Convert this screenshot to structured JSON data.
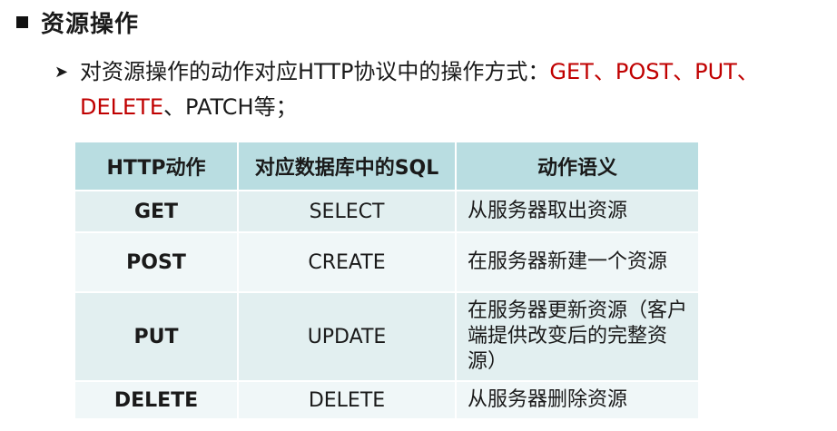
{
  "heading": {
    "title": "资源操作"
  },
  "bullet": {
    "text_before": "对资源操作的动作对应HTTP协议中的操作方式：",
    "methods_line1": "GET、POST、PUT、",
    "methods_line2_red": "DELETE",
    "methods_line2_rest": "、PATCH等；"
  },
  "table": {
    "headers": [
      "HTTP动作",
      "对应数据库中的SQL",
      "动作语义"
    ],
    "rows": [
      {
        "action": "GET",
        "sql": "SELECT",
        "meaning": "从服务器取出资源"
      },
      {
        "action": "POST",
        "sql": "CREATE",
        "meaning": "在服务器新建一个资源"
      },
      {
        "action": "PUT",
        "sql": "UPDATE",
        "meaning": "在服务器更新资源（客户端提供改变后的完整资源）"
      },
      {
        "action": "DELETE",
        "sql": "DELETE",
        "meaning": "从服务器删除资源"
      }
    ]
  },
  "colors": {
    "accent_red": "#c00000",
    "header_bg": "#b9dde1",
    "row_bg": "#e2eff0"
  }
}
